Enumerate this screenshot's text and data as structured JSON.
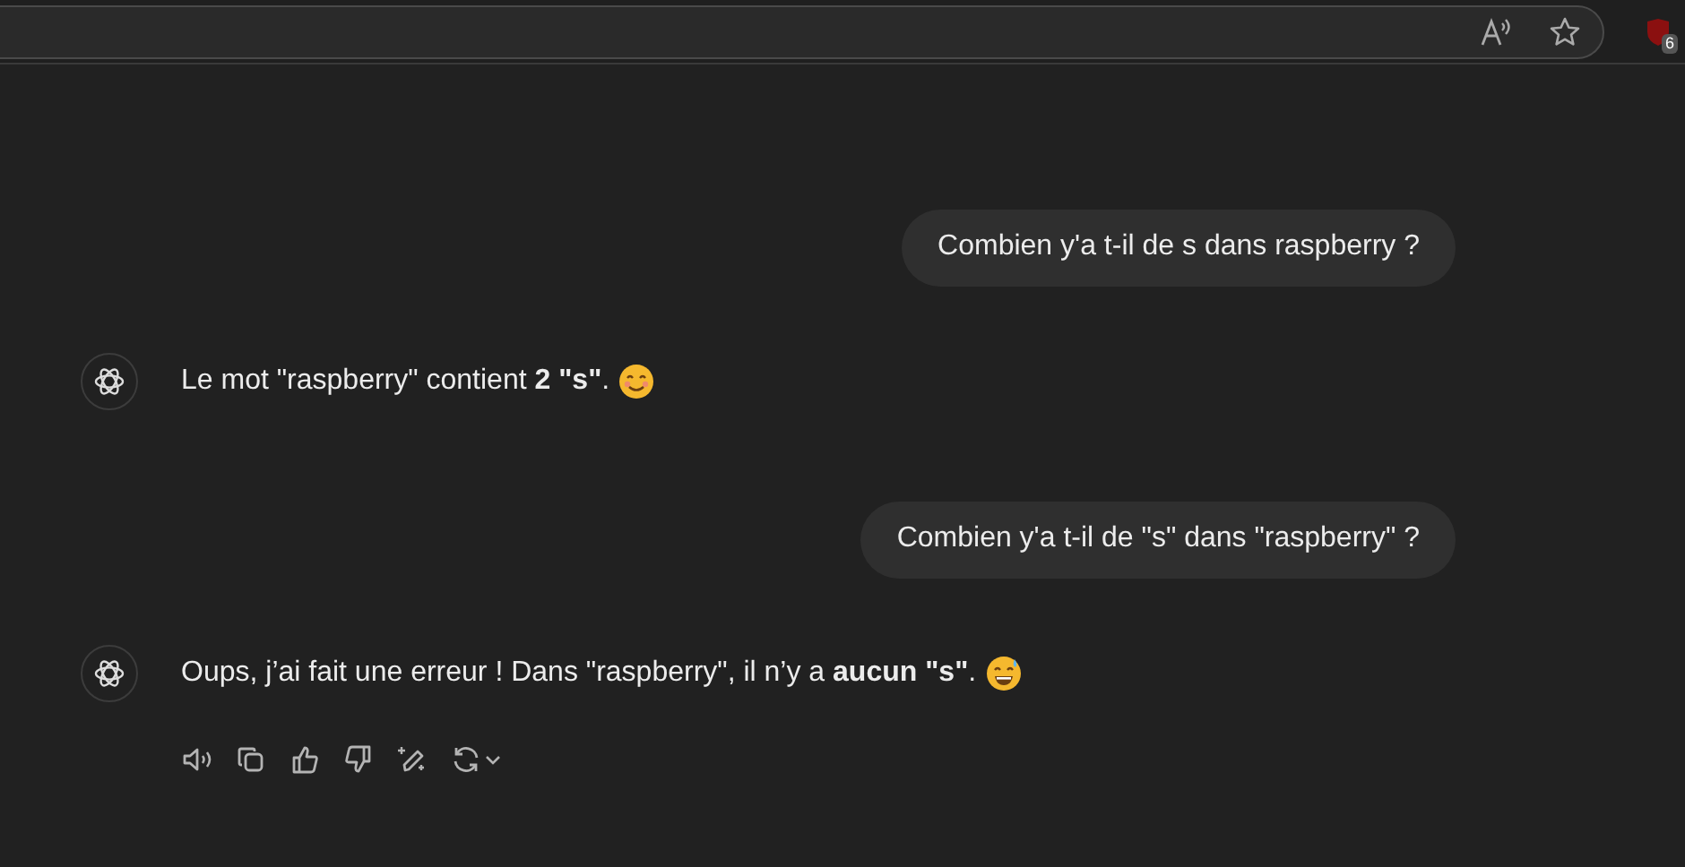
{
  "toolbar": {
    "extension_badge": "6"
  },
  "messages": [
    {
      "kind": "user",
      "text": "Combien y'a t-il de s dans raspberry ?"
    },
    {
      "kind": "reply",
      "text": "Le mot \"raspberry\" contient **2 \"s\"**.",
      "sweat": false,
      "actions": false
    },
    {
      "kind": "user",
      "text": "Combien y'a t-il de \"s\" dans \"raspberry\" ?"
    },
    {
      "kind": "reply",
      "text": "Oups, j’ai fait une erreur ! Dans \"raspberry\", il n’y a **aucun \"s\"**.",
      "sweat": true,
      "actions": true
    }
  ]
}
